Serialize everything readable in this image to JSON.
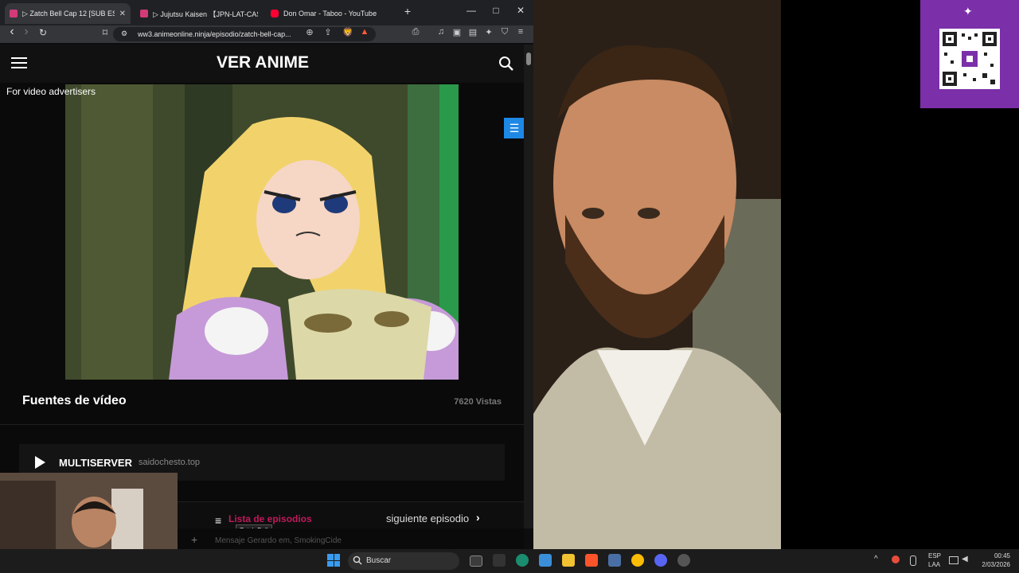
{
  "browser": {
    "tabs": [
      {
        "label": "▷ Zatch Bell Cap 12 [SUB ES",
        "active": true
      },
      {
        "label": "▷ Jujutsu Kaisen 【JPN-LAT-CAST】(",
        "active": false
      },
      {
        "label": "Don Omar - Taboo - YouTube",
        "active": false
      }
    ],
    "new_tab": "+",
    "minimize": "—",
    "maximize": "□",
    "close": "✕",
    "url": "ww3.animeonline.ninja/episodio/zatch-bell-cap...",
    "back": "‹",
    "forward": "›",
    "reload": "↻",
    "bookmark": "⌑",
    "site_info": "⚙",
    "zoom": "⊕",
    "share": "⇪",
    "brave_icon": "🦁",
    "rewards": "▲",
    "tools": [
      "⎙",
      "♫",
      "▣",
      "▤",
      "✦",
      "⛉",
      "≡"
    ]
  },
  "site": {
    "brand": "VER ANIME",
    "ad_label": "For video advertisers",
    "side_button": "☰",
    "sources_title": "Fuentes de vídeo",
    "views": "7620 Vistas",
    "server_name": "MULTISERVER",
    "server_host": "saidochesto.top",
    "list_label": "Lista de episodios",
    "tooltip": "Zatch Bell",
    "next_label": "siguiente episodio",
    "next_icon": "›",
    "list_icon": "≡"
  },
  "chat": {
    "plus": "+",
    "placeholder": "Mensaje Gerardo em, SmokingCide"
  },
  "taskbar": {
    "search_label": "Buscar",
    "lang_1": "ESP",
    "lang_2": "LAA",
    "time": "00:45",
    "date": "2/03/2026",
    "tray_up": "^"
  },
  "colors": {
    "accent_blue": "#1e88e5",
    "list_pink": "#c2185b",
    "qr_purple": "#7b2fa8"
  }
}
